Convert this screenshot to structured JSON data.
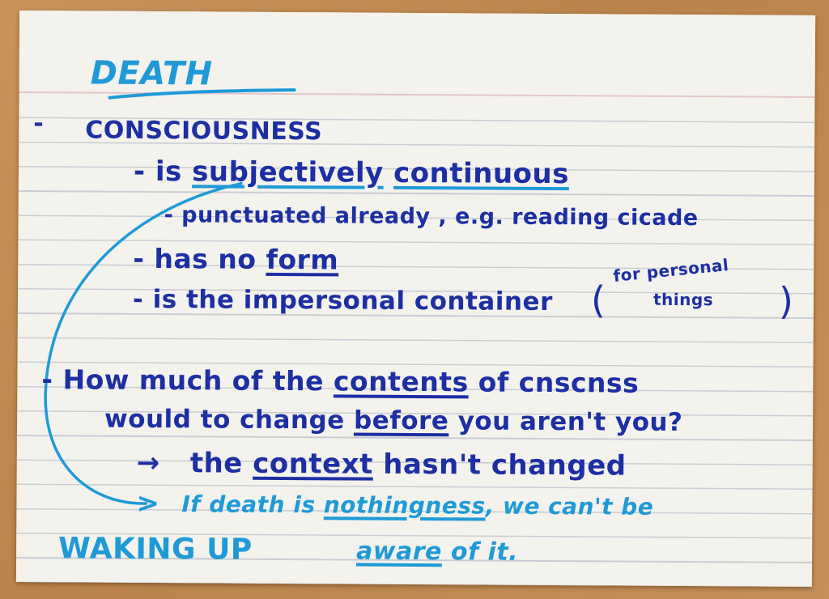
{
  "title": "DEATH",
  "section1": {
    "bullet": "-",
    "heading": "CONSCIOUSNESS",
    "item1": {
      "pre": "- is",
      "w1": "subjectively",
      "w2": "continuous"
    },
    "item1a": "- punctuated already , e.g. reading cicade",
    "item2": {
      "pre": "- has no",
      "w": "form"
    },
    "item3": {
      "text": "- is the impersonal container",
      "paren_open": "(",
      "paren_line1": "for personal",
      "paren_line2": "things",
      "paren_close": ")"
    }
  },
  "section2": {
    "line1": {
      "pre": "- How much of the",
      "w": "contents",
      "post": "of cnscnss"
    },
    "line2": {
      "pre": "would to change",
      "w": "before",
      "post": "you aren't you?"
    },
    "line3": {
      "arrow": "→",
      "pre": "the",
      "w": "context",
      "post": "hasn't changed"
    }
  },
  "footer": {
    "arrow": ">",
    "line1": {
      "pre": "If death is",
      "w": "nothingness",
      "post": ", we can't be"
    },
    "line2": {
      "pre": "",
      "w": "aware",
      "post": "of it."
    },
    "waking": "WAKING UP"
  },
  "colors": {
    "navy_ink": "#1d2fa3",
    "cyan_ink": "#1f9ad7",
    "paper": "#f3f2ec",
    "desk": "#c48f58"
  }
}
